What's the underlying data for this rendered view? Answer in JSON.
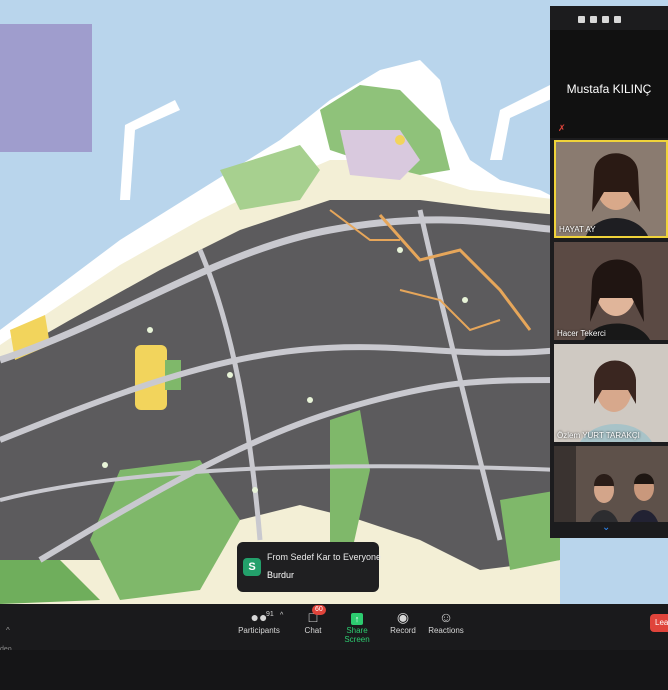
{
  "meeting": {
    "active_speaker": {
      "name": "Mustafa KILINÇ"
    },
    "participants": [
      {
        "name": "HAYAT AY",
        "is_active": true
      },
      {
        "name": "Hacer Tekerci"
      },
      {
        "name": "Özlem YURT TARAKÇI"
      },
      {
        "name": ""
      }
    ],
    "chat_notification": {
      "avatar_letter": "S",
      "from": "From Sedef Kar to Everyone",
      "message": "Burdur"
    }
  },
  "toolbar": {
    "participants_label": "Participants",
    "participants_count": "91",
    "chat_label": "Chat",
    "chat_unread": "60",
    "share_label": "Share Screen",
    "record_label": "Record",
    "reactions_label": "Reactions",
    "leave_label": "Leav",
    "left_edge_text": "deo"
  },
  "colors": {
    "sea": "#b9d5ec",
    "land": "#f3efd6",
    "blocks": "#5c5b5d",
    "roads": "#c9c9cf",
    "parks": "#7fb86a",
    "highlight_roads": "#e6a65a",
    "share_green": "#2dcc70",
    "alert_red": "#e0443b"
  }
}
